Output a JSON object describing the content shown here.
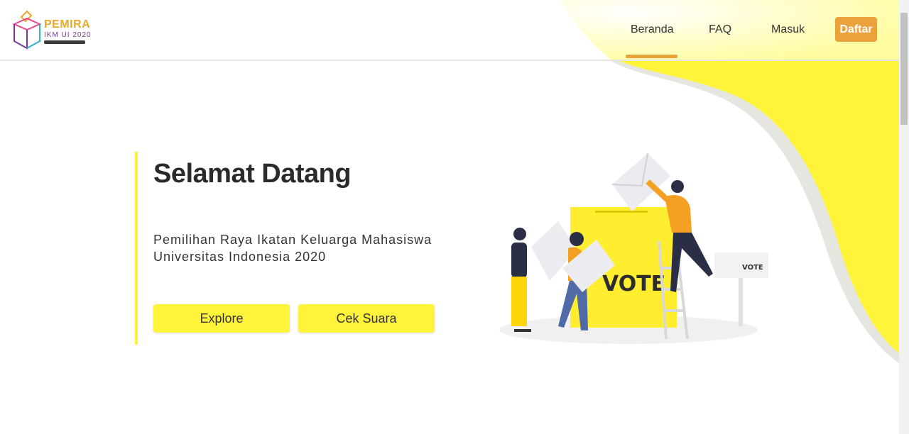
{
  "header": {
    "logo_title": "PEMIRA",
    "logo_subtitle": "IKM UI 2020",
    "nav": [
      {
        "label": "Beranda",
        "active": true
      },
      {
        "label": "FAQ",
        "active": false
      },
      {
        "label": "Masuk",
        "active": false
      }
    ],
    "register_label": "Daftar"
  },
  "hero": {
    "title": "Selamat Datang",
    "subtitle": "Pemilihan Raya Ikatan Keluarga Mahasiswa Universitas Indonesia 2020",
    "buttons": [
      {
        "label": "Explore"
      },
      {
        "label": "Cek Suara"
      }
    ]
  },
  "illustration": {
    "box_label": "VOTE",
    "sign_label": "VOTE"
  },
  "colors": {
    "accent_yellow": "#fff43a",
    "accent_orange": "#eca23a",
    "nav_active": "#e8a33b"
  }
}
